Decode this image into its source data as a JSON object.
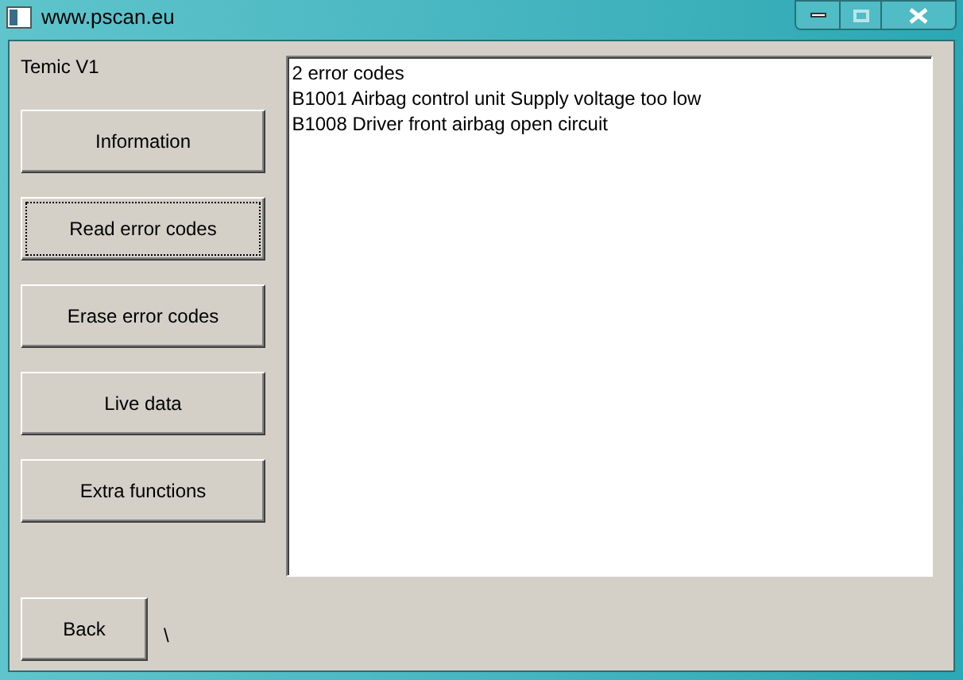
{
  "window": {
    "title": "www.pscan.eu"
  },
  "module_label": "Temic V1",
  "menu_buttons": [
    {
      "label": "Information",
      "focused": false
    },
    {
      "label": "Read error codes",
      "focused": true
    },
    {
      "label": "Erase error codes",
      "focused": false
    },
    {
      "label": "Live data",
      "focused": false
    },
    {
      "label": "Extra functions",
      "focused": false
    }
  ],
  "output_lines": [
    "2 error codes",
    "B1001 Airbag control unit Supply voltage too low",
    "B1008 Driver front airbag open circuit"
  ],
  "back_button": "Back",
  "status_text": "\\"
}
